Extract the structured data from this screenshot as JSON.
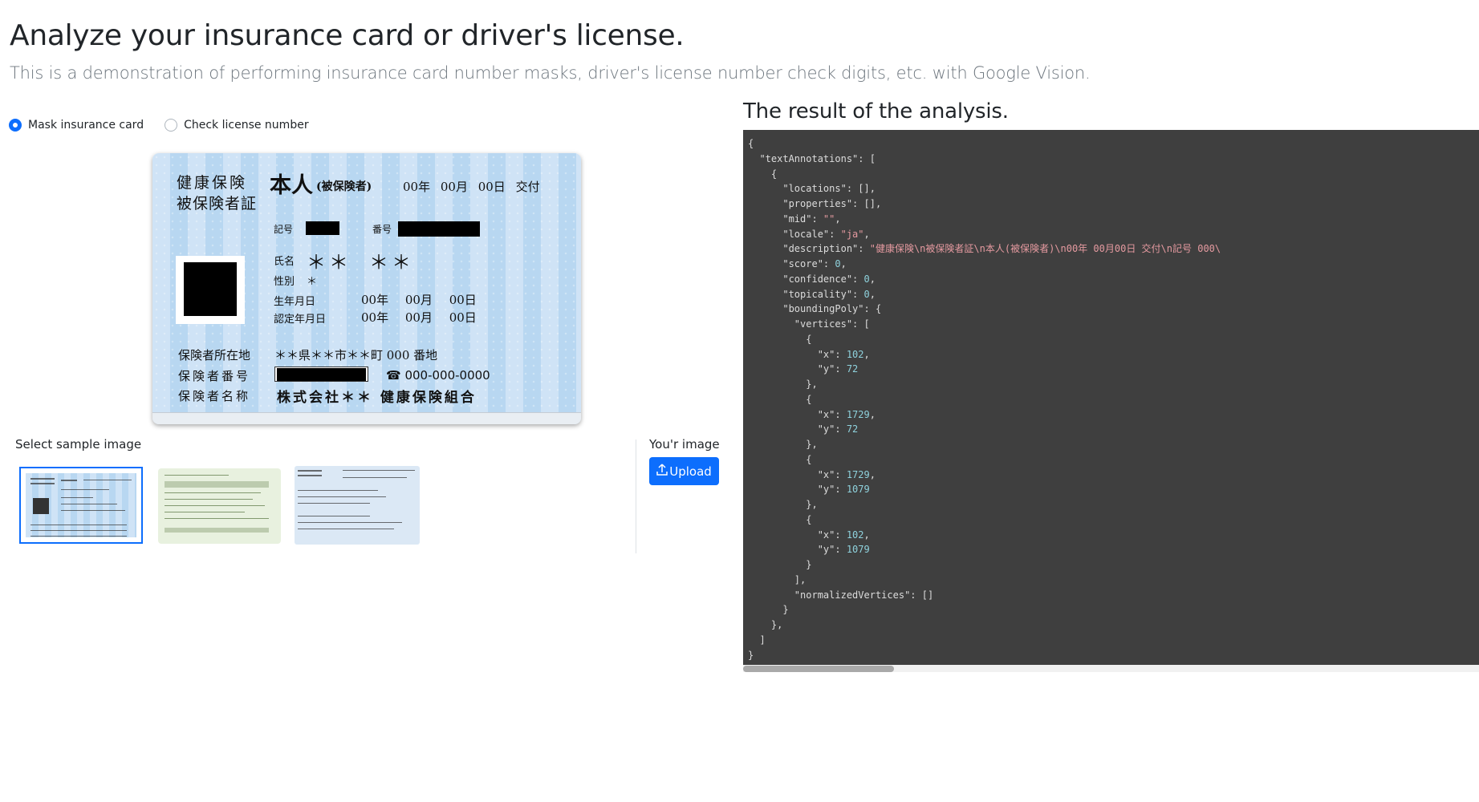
{
  "page": {
    "title": "Analyze your insurance card or driver's license.",
    "subtitle": "This is a demonstration of performing insurance card number masks, driver's license number check digits, etc. with Google Vision."
  },
  "modes": [
    {
      "label": "Mask insurance card",
      "checked": true
    },
    {
      "label": "Check license number",
      "checked": false
    }
  ],
  "card": {
    "title_line1": "健康保険",
    "title_line2": "被保険者証",
    "honnin": "本人",
    "hihokensha": "(被保険者)",
    "issue_date": "00年 00月 00日 交付",
    "kigo_label": "記号",
    "bango_label": "番号",
    "name_label": "氏名",
    "name_value_1": "＊＊",
    "name_value_2": "＊＊",
    "sex_label": "性別",
    "sex_value": "＊",
    "birth_label": "生年月日",
    "birth_value": "00年 00月 00日",
    "cert_label": "認定年月日",
    "cert_value": "00年 00月 00日",
    "address_label": "保険者所在地",
    "address_value": "＊＊県＊＊市＊＊町 000 番地",
    "insurer_number_label": "保険者番号",
    "phone": "☎ 000-000-0000",
    "insurer_name_label": "保険者名称",
    "insurer_name_value": "株式会社＊＊ 健康保険組合"
  },
  "samples": {
    "label": "Select sample image",
    "selected_index": 0
  },
  "upload": {
    "label": "You'r image",
    "button": "Upload",
    "button_icon": "upload-icon"
  },
  "result": {
    "title": "The result of the analysis.",
    "json_lines": [
      [
        [
          "k",
          "{"
        ]
      ],
      [
        [
          "k",
          "  \"textAnnotations\": ["
        ]
      ],
      [
        [
          "k",
          "    {"
        ]
      ],
      [
        [
          "k",
          "      \"locations\": [],"
        ]
      ],
      [
        [
          "k",
          "      \"properties\": [],"
        ]
      ],
      [
        [
          "k",
          "      \"mid\": "
        ],
        [
          "s",
          "\"\""
        ],
        [
          "k",
          ","
        ]
      ],
      [
        [
          "k",
          "      \"locale\": "
        ],
        [
          "s",
          "\"ja\""
        ],
        [
          "k",
          ","
        ]
      ],
      [
        [
          "k",
          "      \"description\": "
        ],
        [
          "s",
          "\"健康保険\\n被保険者証\\n本人(被保険者)\\n00年 00月00日 交付\\n記号 000\\"
        ]
      ],
      [
        [
          "k",
          "      \"score\": "
        ],
        [
          "n",
          "0"
        ],
        [
          "k",
          ","
        ]
      ],
      [
        [
          "k",
          "      \"confidence\": "
        ],
        [
          "n",
          "0"
        ],
        [
          "k",
          ","
        ]
      ],
      [
        [
          "k",
          "      \"topicality\": "
        ],
        [
          "n",
          "0"
        ],
        [
          "k",
          ","
        ]
      ],
      [
        [
          "k",
          "      \"boundingPoly\": {"
        ]
      ],
      [
        [
          "k",
          "        \"vertices\": ["
        ]
      ],
      [
        [
          "k",
          "          {"
        ]
      ],
      [
        [
          "k",
          "            \"x\": "
        ],
        [
          "n",
          "102"
        ],
        [
          "k",
          ","
        ]
      ],
      [
        [
          "k",
          "            \"y\": "
        ],
        [
          "n",
          "72"
        ]
      ],
      [
        [
          "k",
          "          },"
        ]
      ],
      [
        [
          "k",
          "          {"
        ]
      ],
      [
        [
          "k",
          "            \"x\": "
        ],
        [
          "n",
          "1729"
        ],
        [
          "k",
          ","
        ]
      ],
      [
        [
          "k",
          "            \"y\": "
        ],
        [
          "n",
          "72"
        ]
      ],
      [
        [
          "k",
          "          },"
        ]
      ],
      [
        [
          "k",
          "          {"
        ]
      ],
      [
        [
          "k",
          "            \"x\": "
        ],
        [
          "n",
          "1729"
        ],
        [
          "k",
          ","
        ]
      ],
      [
        [
          "k",
          "            \"y\": "
        ],
        [
          "n",
          "1079"
        ]
      ],
      [
        [
          "k",
          "          },"
        ]
      ],
      [
        [
          "k",
          "          {"
        ]
      ],
      [
        [
          "k",
          "            \"x\": "
        ],
        [
          "n",
          "102"
        ],
        [
          "k",
          ","
        ]
      ],
      [
        [
          "k",
          "            \"y\": "
        ],
        [
          "n",
          "1079"
        ]
      ],
      [
        [
          "k",
          "          }"
        ]
      ],
      [
        [
          "k",
          "        ],"
        ]
      ],
      [
        [
          "k",
          "        \"normalizedVertices\": []"
        ]
      ],
      [
        [
          "k",
          "      }"
        ]
      ],
      [
        [
          "k",
          "    },"
        ]
      ],
      [
        [
          "k",
          "  ]"
        ]
      ],
      [
        [
          "k",
          "}"
        ]
      ]
    ]
  },
  "colors": {
    "accent": "#0d6efd",
    "code_bg": "#3f3f3f",
    "code_string": "#e59aa0",
    "code_number": "#8fd2dd"
  }
}
